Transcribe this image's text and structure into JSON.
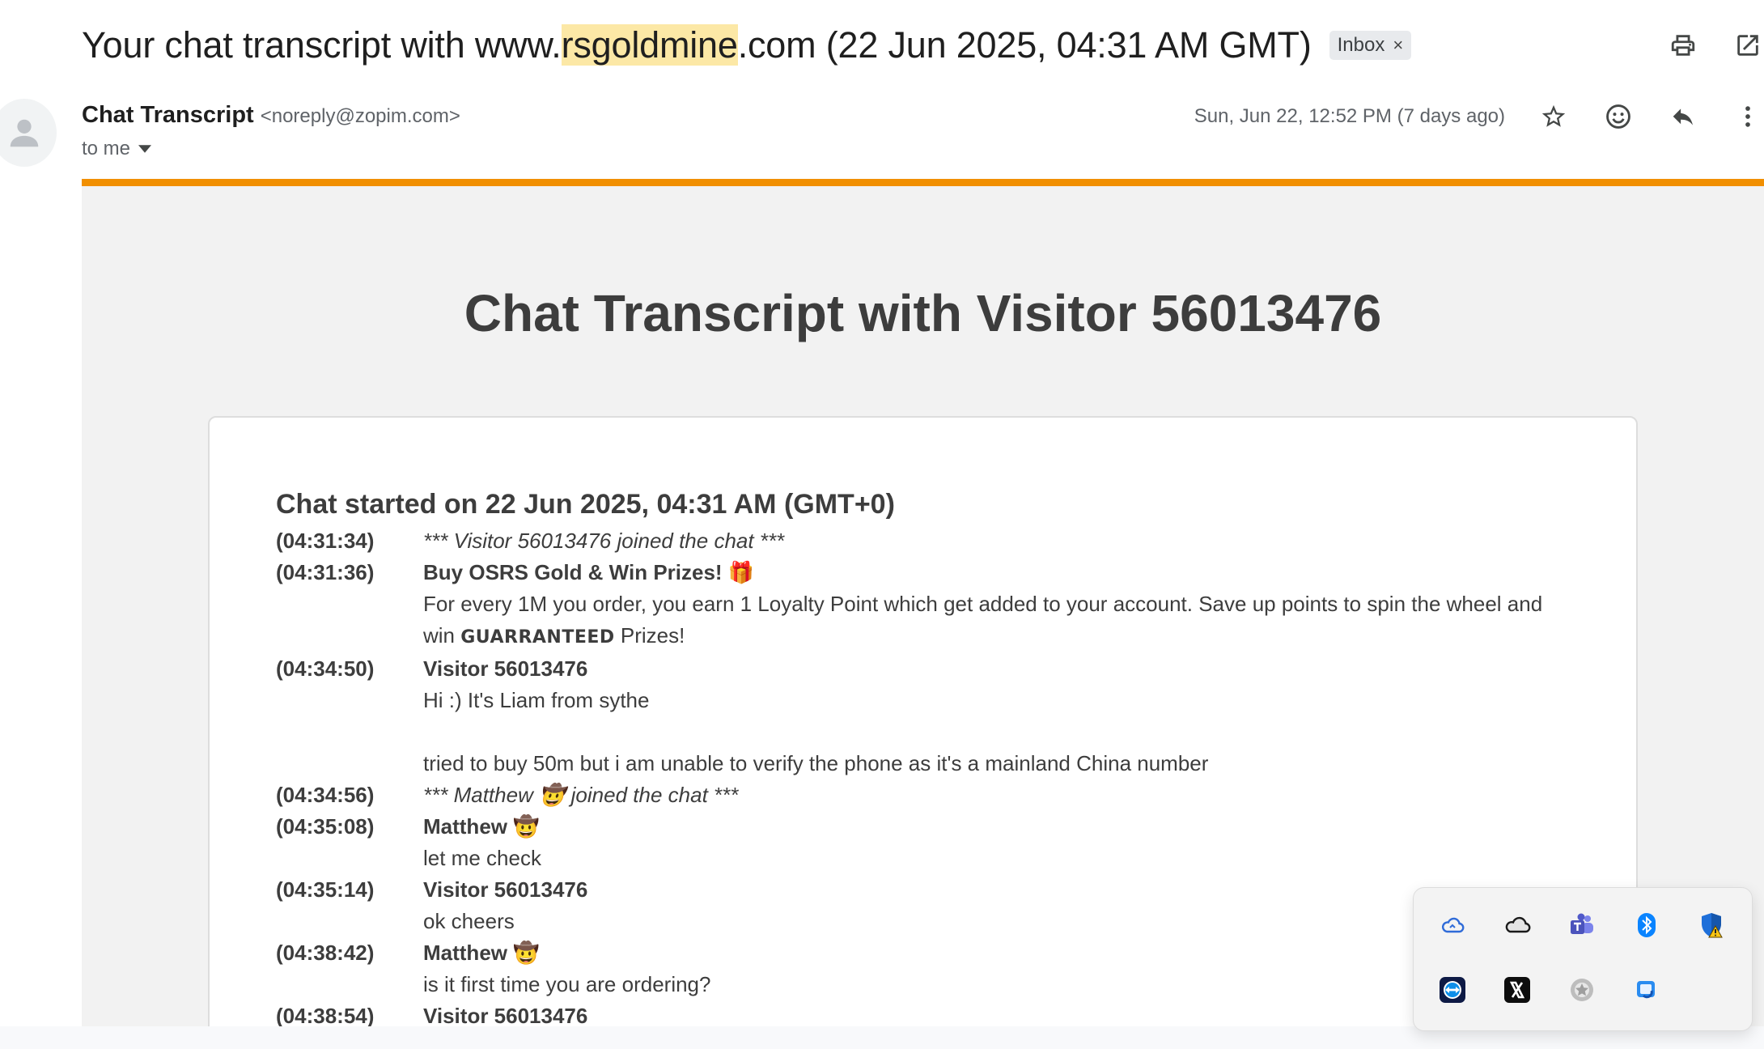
{
  "email": {
    "subject_prefix": "Your chat transcript with www.",
    "subject_highlight": "rsgoldmine",
    "subject_suffix": ".com (22 Jun 2025, 04:31 AM GMT)",
    "label": "Inbox",
    "label_close": "×",
    "sender_name": "Chat Transcript",
    "sender_email": "<noreply@zopim.com>",
    "recipient": "to me",
    "date": "Sun, Jun 22, 12:52 PM (7 days ago)",
    "icons": [
      "print-icon",
      "open-new-window-icon",
      "star-icon",
      "emoji-icon",
      "reply-icon",
      "more-vert-icon"
    ]
  },
  "transcript": {
    "title": "Chat Transcript with Visitor 56013476",
    "started": "Chat started on 22 Jun 2025, 04:31 AM (GMT+0)",
    "lines": [
      {
        "ts": "(04:31:34)",
        "text": "*** Visitor 56013476 joined the chat ***"
      },
      {
        "ts": "(04:31:36)",
        "text": "Buy OSRS Gold & Win Prizes! 🎁"
      },
      {
        "ts": "",
        "text": "For every 1M you order, you earn 1 Loyalty Point which get added to your account. Save up points to spin the wheel and"
      },
      {
        "ts": "",
        "text_a": "win ",
        "text_b": "GUARRANTEED",
        "text_c": " Prizes!"
      },
      {
        "ts": "(04:34:50)",
        "text": "Visitor 56013476"
      },
      {
        "ts": "",
        "text": "Hi :) It's Liam from sythe"
      },
      {
        "ts": "",
        "text": ""
      },
      {
        "ts": "",
        "text": "tried to buy 50m but i am unable to verify the phone as it's a mainland China number"
      },
      {
        "ts": "(04:34:56)",
        "text": "*** Matthew 🤠 joined the chat ***"
      },
      {
        "ts": "(04:35:08)",
        "text": "Matthew 🤠"
      },
      {
        "ts": "",
        "text": "let me check"
      },
      {
        "ts": "(04:35:14)",
        "text": "Visitor 56013476"
      },
      {
        "ts": "",
        "text": "ok cheers"
      },
      {
        "ts": "(04:38:42)",
        "text": "Matthew 🤠"
      },
      {
        "ts": "",
        "text": "is it first time you are ordering?"
      },
      {
        "ts": "(04:38:54)",
        "text": "Visitor 56013476"
      }
    ]
  },
  "tray": {
    "items": [
      "icloud-icon",
      "onedrive-icon",
      "teams-icon",
      "bluetooth-icon",
      "defender-warning-icon",
      "teamviewer-icon",
      "x-app-icon",
      "settings-gear-icon",
      "snipping-tool-icon"
    ]
  },
  "colors": {
    "accent_bar": "#f18f01",
    "highlight": "#fce8a6"
  }
}
